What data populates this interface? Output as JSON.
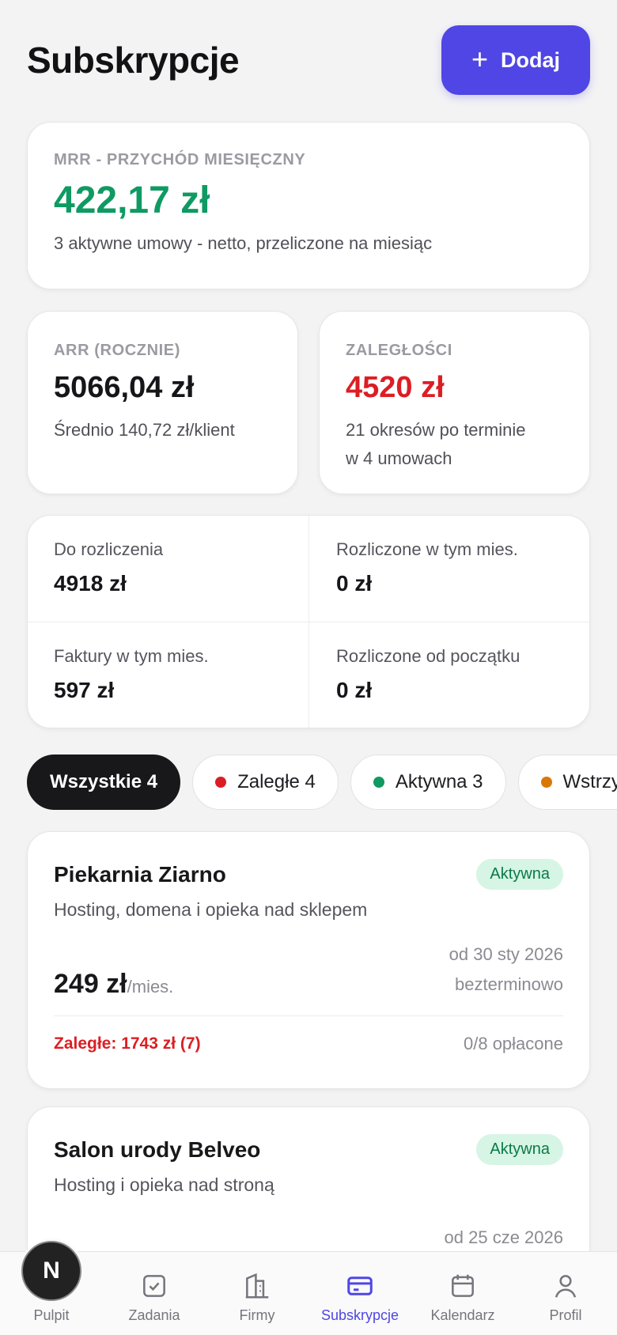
{
  "header": {
    "title": "Subskrypcje",
    "add_label": "Dodaj"
  },
  "mrr": {
    "label": "MRR - PRZYCHÓD MIESIĘCZNY",
    "value": "422,17 zł",
    "sub": "3 aktywne umowy - netto, przeliczone na miesiąc",
    "value_color": "#0f9a63"
  },
  "arr": {
    "label": "ARR (ROCZNIE)",
    "value": "5066,04 zł",
    "sub": "Średnio 140,72 zł/klient"
  },
  "overdue": {
    "label": "ZALEGŁOŚCI",
    "value": "4520 zł",
    "sub_line1": "21 okresów po terminie",
    "sub_line2": "w 4 umowach",
    "value_color": "#dc1e24"
  },
  "stats": [
    {
      "label": "Do rozliczenia",
      "value": "4918 zł"
    },
    {
      "label": "Rozliczone w tym mies.",
      "value": "0 zł"
    },
    {
      "label": "Faktury w tym mies.",
      "value": "597 zł"
    },
    {
      "label": "Rozliczone od początku",
      "value": "0 zł"
    }
  ],
  "filters": [
    {
      "label": "Wszystkie 4",
      "active": true
    },
    {
      "label": "Zaległe 4",
      "dot": "#dc1e24"
    },
    {
      "label": "Aktywna 3",
      "dot": "#0f9a63"
    },
    {
      "label": "Wstrzymana",
      "dot": "#d97706"
    }
  ],
  "subscriptions": [
    {
      "name": "Piekarnia Ziarno",
      "status": "Aktywna",
      "description": "Hosting, domena i opieka nad sklepem",
      "price": "249 zł",
      "unit": "/mies.",
      "date_from": "od 30 sty 2026",
      "term": "bezterminowo",
      "overdue": "Zaległe: 1743 zł (7)",
      "paid": "0/8 opłacone"
    },
    {
      "name": "Salon urody Belveo",
      "status": "Aktywna",
      "description": "Hosting i opieka nad stroną",
      "date_from": "od 25 cze 2026"
    }
  ],
  "tabs": [
    {
      "label": "Pulpit",
      "icon": "app-logo-icon"
    },
    {
      "label": "Zadania",
      "icon": "checkbox-icon"
    },
    {
      "label": "Firmy",
      "icon": "building-icon"
    },
    {
      "label": "Subskrypcje",
      "icon": "credit-card-icon",
      "active": true
    },
    {
      "label": "Kalendarz",
      "icon": "calendar-icon"
    },
    {
      "label": "Profil",
      "icon": "user-icon"
    }
  ],
  "accent": "#4f46e5"
}
